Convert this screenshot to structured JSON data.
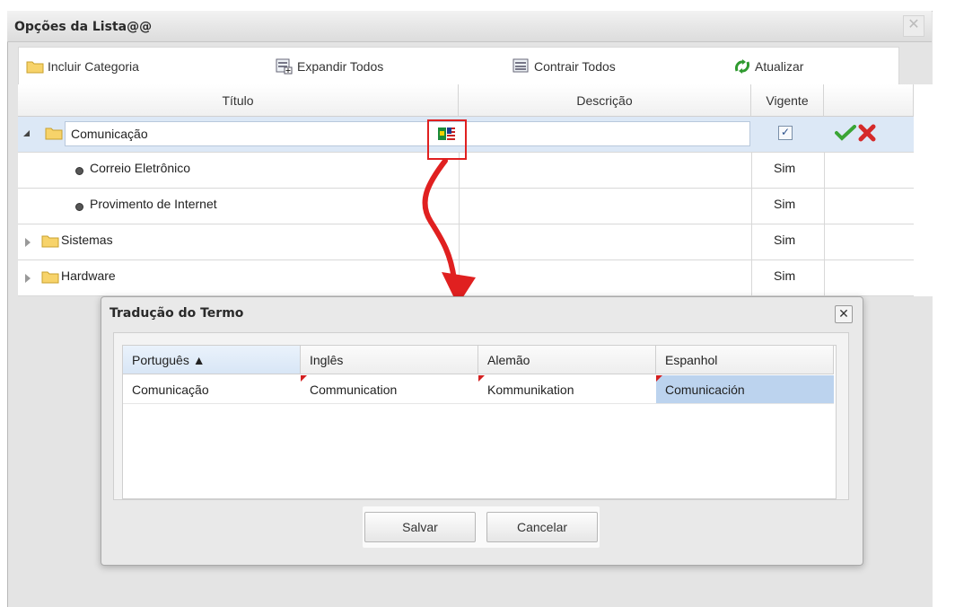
{
  "window": {
    "title": "Opções da Lista@@",
    "close_label": "✕"
  },
  "toolbar": {
    "add_category": "Incluir Categoria",
    "expand_all": "Expandir Todos",
    "collapse_all": "Contrair Todos",
    "refresh": "Atualizar"
  },
  "grid": {
    "columns": {
      "title": "Título",
      "description": "Descrição",
      "current": "Vigente"
    },
    "rows": [
      {
        "title": "Comunicação",
        "current": ""
      },
      {
        "title": "Correio Eletrônico",
        "current": "Sim"
      },
      {
        "title": "Provimento de Internet",
        "current": "Sim"
      },
      {
        "title": "Sistemas",
        "current": "Sim"
      },
      {
        "title": "Hardware",
        "current": "Sim"
      }
    ]
  },
  "modal": {
    "title": "Tradução do Termo",
    "close_label": "✕",
    "columns": [
      "Português ▲",
      "Inglês",
      "Alemão",
      "Espanhol"
    ],
    "row": [
      "Comunicação",
      "Communication",
      "Kommunikation",
      "Comunicación"
    ],
    "save": "Salvar",
    "cancel": "Cancelar"
  },
  "icons": [
    "folder-icon",
    "expand-all-icon",
    "collapse-all-icon",
    "refresh-icon",
    "translate-icon",
    "confirm-icon",
    "cancel-edit-icon",
    "checkbox-icon",
    "tree-toggle-icon",
    "bullet-icon"
  ],
  "colors": {
    "highlight": "#e02020",
    "selected_row": "#dce8f6",
    "selected_cell": "#bcd3ee",
    "confirm": "#3aa535",
    "cancel": "#d52a2a"
  }
}
